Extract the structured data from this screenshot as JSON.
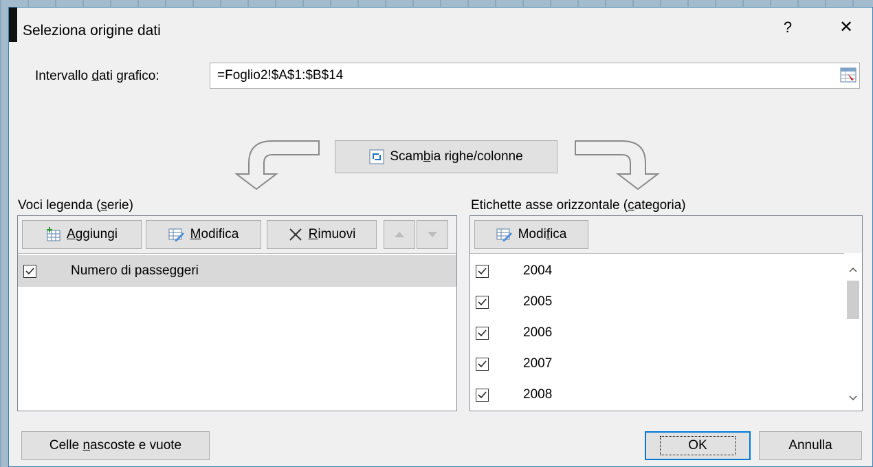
{
  "dialog": {
    "title": "Seleziona origine dati",
    "help": "?",
    "close": "✕"
  },
  "range": {
    "label_pre": "Intervallo ",
    "label_u": "d",
    "label_post": "ati grafico:",
    "value": "=Foglio2!$A$1:$B$14"
  },
  "swap": {
    "pre": "Scam",
    "u": "b",
    "post": "ia righe/colonne"
  },
  "legend": {
    "heading_pre": "Voci legenda (",
    "heading_u": "s",
    "heading_post": "erie)",
    "add": {
      "u": "A",
      "rest": "ggiungi"
    },
    "edit": {
      "u": "M",
      "rest": "odifica"
    },
    "remove": {
      "u": "R",
      "rest": "imuovi"
    },
    "items": [
      {
        "label": "Numero di passeggeri",
        "checked": true
      }
    ]
  },
  "axis": {
    "heading_pre": "Etichette asse orizzontale (",
    "heading_u": "c",
    "heading_post": "ategoria)",
    "edit": {
      "pre": "Modi",
      "u": "f",
      "post": "ica"
    },
    "items": [
      "2004",
      "2005",
      "2006",
      "2007",
      "2008"
    ]
  },
  "footer": {
    "hidden": {
      "pre": "Celle ",
      "u": "n",
      "post": "ascoste e vuote"
    },
    "ok": "OK",
    "cancel": "Annulla"
  },
  "colors": {
    "accent": "#0078d7",
    "dialog_bg": "#f0f0f0",
    "selected_row": "#cce8ff"
  }
}
